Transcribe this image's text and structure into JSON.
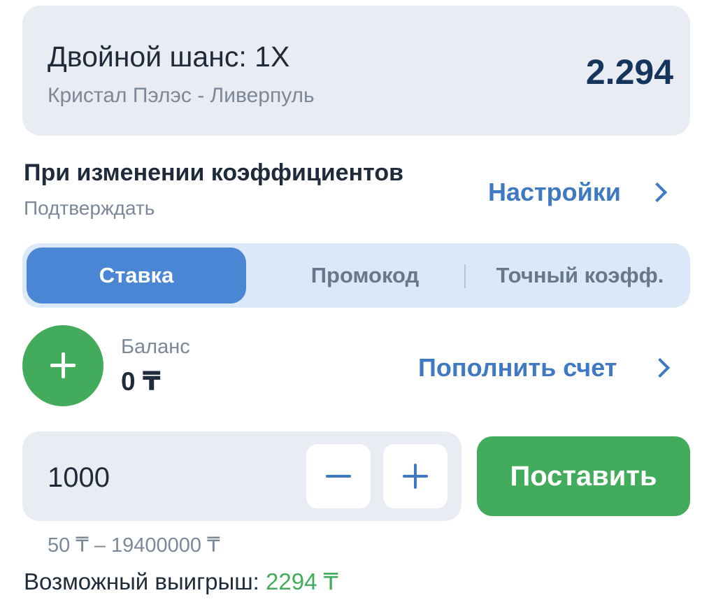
{
  "bet": {
    "title": "Двойной шанс: 1X",
    "match": "Кристал Пэлэс - Ливерпуль",
    "odds": "2.294"
  },
  "odds_change": {
    "title": "При изменении коэффициентов",
    "value": "Подтверждать",
    "settings_label": "Настройки"
  },
  "tabs": [
    {
      "label": "Ставка",
      "active": true
    },
    {
      "label": "Промокод",
      "active": false
    },
    {
      "label": "Точный коэфф.",
      "active": false
    }
  ],
  "balance": {
    "label": "Баланс",
    "value": "0 ₸",
    "topup_label": "Пополнить счет"
  },
  "stake": {
    "value": "1000",
    "place_bet_label": "Поставить",
    "limits": "50 ₸ – 19400000 ₸"
  },
  "potential_win": {
    "label": "Возможный выигрыш:",
    "value": "2294 ₸"
  },
  "colors": {
    "accent_blue": "#3f79c2",
    "active_tab": "#4a86d4",
    "green": "#43ac5c",
    "card_bg": "#e9edf3"
  },
  "icons": {
    "settings_chevron": "chevron-right-icon",
    "topup_chevron": "chevron-right-icon",
    "topup": "plus-icon",
    "decrement": "minus-icon",
    "increment": "plus-icon"
  }
}
